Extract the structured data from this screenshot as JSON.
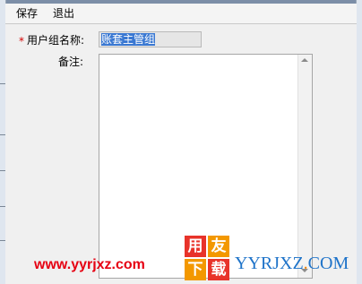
{
  "menu": {
    "save_label": "保存",
    "exit_label": "退出"
  },
  "form": {
    "required_marker": "*",
    "group_name_label": "用户组名称:",
    "group_name_value": "账套主管组",
    "remark_label": "备注:",
    "remark_value": ""
  },
  "watermark": {
    "url": "www.yyrjxz.com",
    "logo_chars": [
      "用",
      "友",
      "下",
      "载"
    ],
    "brand_part1": "YYRJXZ",
    "brand_part2": ".",
    "brand_part3": "COM"
  },
  "colors": {
    "required": "#d40000",
    "selection": "#3a78d2",
    "watermark_red": "#e60012",
    "brand_blue": "#1e73c9",
    "brand_orange": "#f08300"
  }
}
